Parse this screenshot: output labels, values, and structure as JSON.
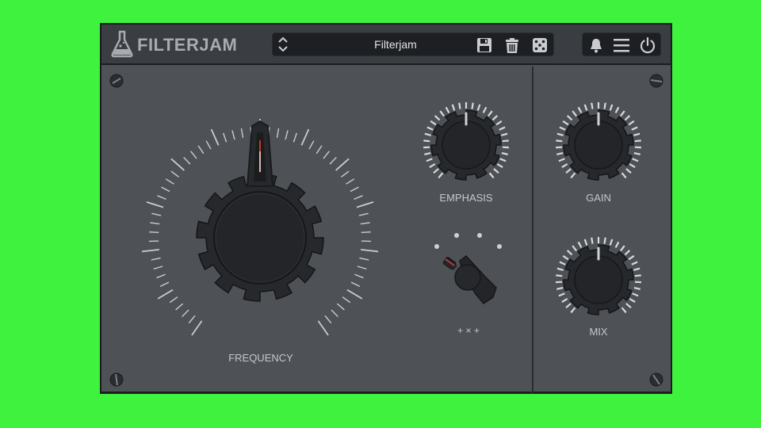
{
  "brand": {
    "name": "FILTERJAM"
  },
  "preset": {
    "name": "Filterjam"
  },
  "knobs": {
    "frequency": {
      "label": "FREQUENCY"
    },
    "emphasis": {
      "label": "EMPHASIS"
    },
    "gain": {
      "label": "GAIN"
    },
    "mix": {
      "label": "MIX"
    }
  },
  "mode_switch": {
    "label": "+ × +"
  },
  "colors": {
    "background": "#3ef23e",
    "panel": "#4e5257",
    "topbar": "#3a3d41",
    "accent_needle": "#c0392b"
  },
  "icons": {
    "logo": "flask-icon",
    "preset_nav": "up-down-arrows-icon",
    "save": "save-icon",
    "delete": "trash-icon",
    "random": "dice-icon",
    "notifications": "bell-icon",
    "menu": "hamburger-menu-icon",
    "power": "power-icon"
  }
}
